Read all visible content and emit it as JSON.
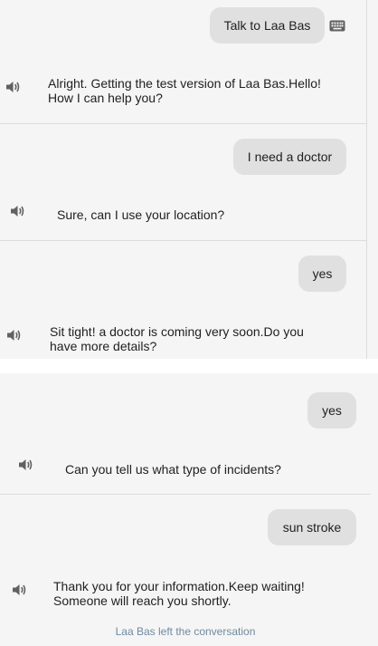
{
  "conversation": {
    "messages": [
      {
        "role": "user",
        "text": "Talk to Laa Bas"
      },
      {
        "role": "bot",
        "text": "Alright. Getting the test version of Laa Bas.Hello! How I can help you?"
      },
      {
        "role": "user",
        "text": "I need a doctor"
      },
      {
        "role": "bot",
        "text": "Sure, can I use your location?"
      },
      {
        "role": "user",
        "text": "yes"
      },
      {
        "role": "bot",
        "text": "Sit tight! a doctor is coming very soon.Do you have more details?"
      },
      {
        "role": "user",
        "text": "yes"
      },
      {
        "role": "bot",
        "text": "Can you tell us what type of incidents?"
      },
      {
        "role": "user",
        "text": "sun stroke"
      },
      {
        "role": "bot",
        "text": "Thank you for your information.Keep waiting! Someone will reach you shortly."
      }
    ],
    "status": "Laa Bas left the conversation"
  },
  "icons": {
    "speaker": "speaker-icon",
    "keyboard": "keyboard-icon"
  },
  "colors": {
    "user_bubble": "#e0e0e0",
    "background": "#f5f5f5",
    "icon": "#616161",
    "status_text": "#6f8aa0"
  }
}
